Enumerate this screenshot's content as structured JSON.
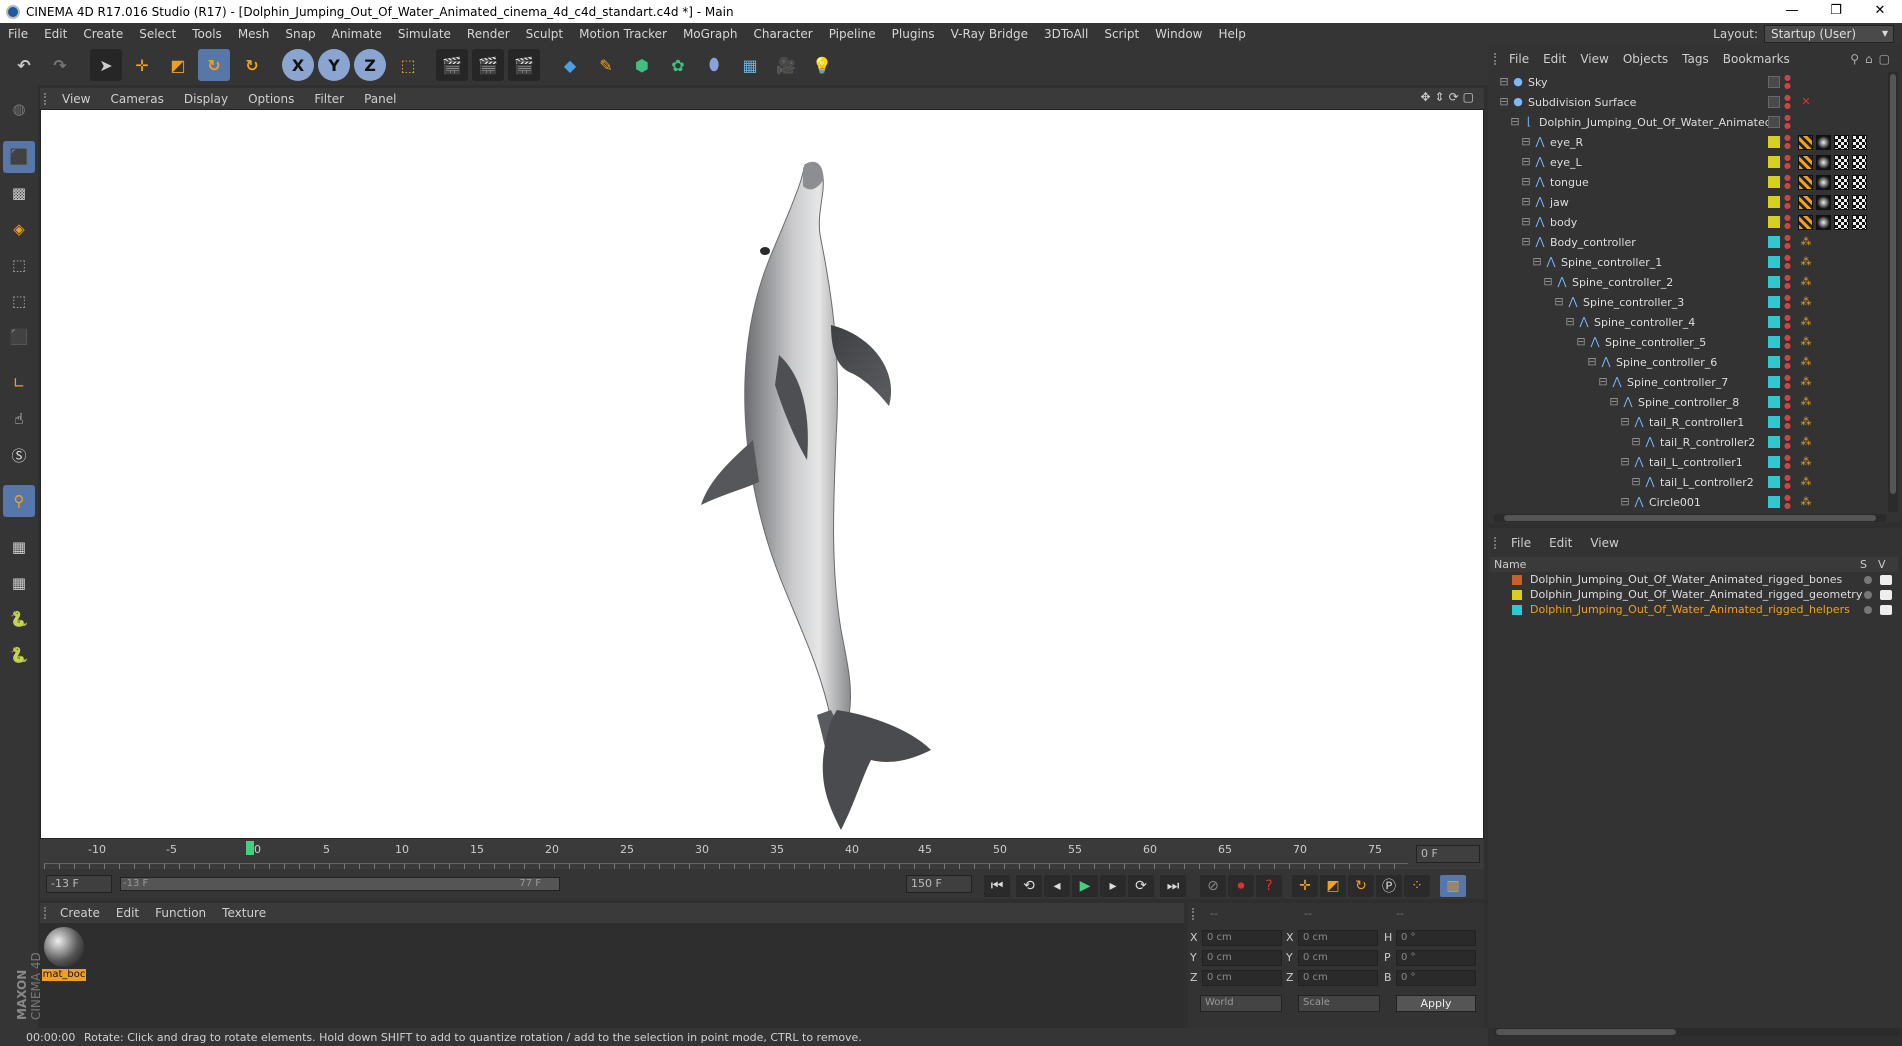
{
  "window": {
    "title": "CINEMA 4D R17.016 Studio (R17) - [Dolphin_Jumping_Out_Of_Water_Animated_cinema_4d_c4d_standart.c4d *] - Main",
    "minimize": "—",
    "restore": "❐",
    "close": "✕"
  },
  "menu": [
    "File",
    "Edit",
    "Create",
    "Select",
    "Tools",
    "Mesh",
    "Snap",
    "Animate",
    "Simulate",
    "Render",
    "Sculpt",
    "Motion Tracker",
    "MoGraph",
    "Character",
    "Pipeline",
    "Plugins",
    "V-Ray Bridge",
    "3DToAll",
    "Script",
    "Window",
    "Help"
  ],
  "layout": {
    "label": "Layout:",
    "value": "Startup (User)"
  },
  "toolbar": {
    "x_label": "X",
    "y_label": "Y",
    "z_label": "Z"
  },
  "viewport_menu": [
    "View",
    "Cameras",
    "Display",
    "Options",
    "Filter",
    "Panel"
  ],
  "timeline": {
    "ticks": [
      "-10",
      "-5",
      "0",
      "5",
      "10",
      "15",
      "20",
      "25",
      "30",
      "35",
      "40",
      "45",
      "50",
      "55",
      "60",
      "65",
      "70",
      "75"
    ],
    "current_frame": "0 F",
    "start_field": "-13 F",
    "range_start": "-13 F",
    "range_end": "77 F",
    "end_field": "150 F"
  },
  "material_menu": [
    "Create",
    "Edit",
    "Function",
    "Texture"
  ],
  "material": {
    "name": "mat_boc"
  },
  "coords": {
    "header": [
      "--",
      "--",
      "--"
    ],
    "rows": [
      {
        "a": "X",
        "av": "0 cm",
        "b": "X",
        "bv": "0 cm",
        "c": "H",
        "cv": "0 °"
      },
      {
        "a": "Y",
        "av": "0 cm",
        "b": "Y",
        "bv": "0 cm",
        "c": "P",
        "cv": "0 °"
      },
      {
        "a": "Z",
        "av": "0 cm",
        "b": "Z",
        "bv": "0 cm",
        "c": "B",
        "cv": "0 °"
      }
    ],
    "mode": "World",
    "scale": "Scale",
    "apply": "Apply"
  },
  "status": {
    "time": "00:00:00",
    "message": "Rotate: Click and drag to rotate elements. Hold down SHIFT to add to quantize rotation / add to the selection in point mode, CTRL to remove."
  },
  "object_menu": [
    "File",
    "Edit",
    "View",
    "Objects",
    "Tags",
    "Bookmarks"
  ],
  "objects": [
    {
      "name": "Sky",
      "indent": 0,
      "color": "",
      "tags": false
    },
    {
      "name": "Subdivision Surface",
      "indent": 0,
      "color": "",
      "tags": false
    },
    {
      "name": "Dolphin_Jumping_Out_Of_Water_Animated",
      "indent": 1,
      "color": "",
      "tags": false
    },
    {
      "name": "eye_R",
      "indent": 2,
      "color": "#d8d020",
      "tags": true
    },
    {
      "name": "eye_L",
      "indent": 2,
      "color": "#d8d020",
      "tags": true
    },
    {
      "name": "tongue",
      "indent": 2,
      "color": "#d8d020",
      "tags": true
    },
    {
      "name": "jaw",
      "indent": 2,
      "color": "#d8d020",
      "tags": true
    },
    {
      "name": "body",
      "indent": 2,
      "color": "#d8d020",
      "tags": true
    },
    {
      "name": "Body_controller",
      "indent": 2,
      "color": "#30c8d0",
      "tags": false
    },
    {
      "name": "Spine_controller_1",
      "indent": 3,
      "color": "#30c8d0",
      "tags": false
    },
    {
      "name": "Spine_controller_2",
      "indent": 4,
      "color": "#30c8d0",
      "tags": false
    },
    {
      "name": "Spine_controller_3",
      "indent": 5,
      "color": "#30c8d0",
      "tags": false
    },
    {
      "name": "Spine_controller_4",
      "indent": 6,
      "color": "#30c8d0",
      "tags": false
    },
    {
      "name": "Spine_controller_5",
      "indent": 7,
      "color": "#30c8d0",
      "tags": false
    },
    {
      "name": "Spine_controller_6",
      "indent": 8,
      "color": "#30c8d0",
      "tags": false
    },
    {
      "name": "Spine_controller_7",
      "indent": 9,
      "color": "#30c8d0",
      "tags": false
    },
    {
      "name": "Spine_controller_8",
      "indent": 10,
      "color": "#30c8d0",
      "tags": false
    },
    {
      "name": "tail_R_controller1",
      "indent": 11,
      "color": "#30c8d0",
      "tags": false
    },
    {
      "name": "tail_R_controller2",
      "indent": 12,
      "color": "#30c8d0",
      "tags": false
    },
    {
      "name": "tail_L_controller1",
      "indent": 11,
      "color": "#30c8d0",
      "tags": false
    },
    {
      "name": "tail_L_controller2",
      "indent": 12,
      "color": "#30c8d0",
      "tags": false
    },
    {
      "name": "Circle001",
      "indent": 11,
      "color": "#30c8d0",
      "tags": false
    }
  ],
  "layer_menu": [
    "File",
    "Edit",
    "View"
  ],
  "layer_header": {
    "name": "Name",
    "s": "S",
    "v": "V"
  },
  "layers": [
    {
      "name": "Dolphin_Jumping_Out_Of_Water_Animated_rigged_bones",
      "color": "#c8602a",
      "active": false
    },
    {
      "name": "Dolphin_Jumping_Out_Of_Water_Animated_rigged_geometry",
      "color": "#d8d020",
      "active": false
    },
    {
      "name": "Dolphin_Jumping_Out_Of_Water_Animated_rigged_helpers",
      "color": "#30c8d0",
      "active": true
    }
  ],
  "brand": {
    "line1": "MAXON",
    "line2": "CINEMA 4D"
  },
  "colors": {
    "accent": "#5677a8",
    "active_layer": "#f0a020"
  }
}
